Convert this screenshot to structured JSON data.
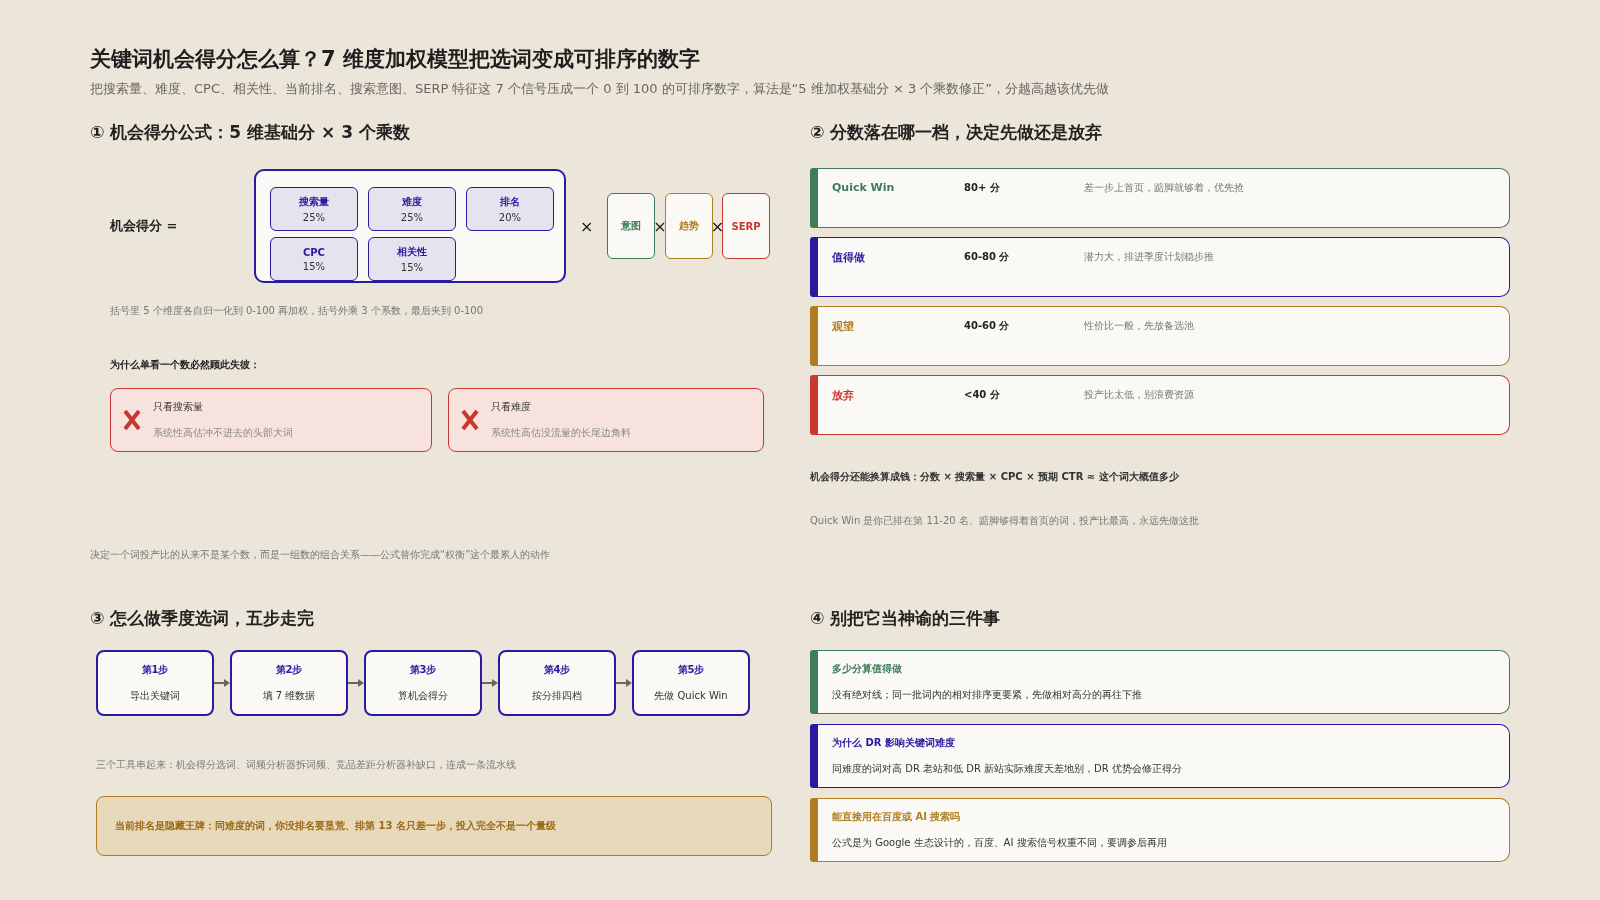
{
  "header": {
    "title": "关键词机会得分怎么算？7 维度加权模型把选词变成可排序的数字",
    "subtitle": "把搜索量、难度、CPC、相关性、当前排名、搜索意图、SERP 特征这 7 个信号压成一个 0 到 100 的可排序数字，算法是“5 维加权基础分 × 3 个乘数修正”，分越高越该优先做"
  },
  "formula_section": {
    "heading": "① 机会得分公式：5 维基础分 × 3 个乘数",
    "lhs": "机会得分 =",
    "weights": [
      {
        "name": "搜索量",
        "weight": "25%"
      },
      {
        "name": "难度",
        "weight": "25%"
      },
      {
        "name": "排名",
        "weight": "20%"
      },
      {
        "name": "CPC",
        "weight": "15%"
      },
      {
        "name": "相关性",
        "weight": "15%"
      }
    ],
    "multipliers": [
      {
        "sign": "×",
        "label": "意图",
        "color": "#3f7d5a"
      },
      {
        "sign": "×",
        "label": "趋势",
        "color": "#b07d22"
      },
      {
        "sign": "×",
        "label": "SERP",
        "color": "#c8382f"
      }
    ],
    "note": "括号里 5 个维度各自归一化到 0-100 再加权，括号外乘 3 个系数，最后夹到 0-100",
    "pitfall_heading": "为什么单看一个数必然顾此失彼：",
    "pitfalls": [
      {
        "title": "只看搜索量",
        "desc": "系统性高估冲不进去的头部大词"
      },
      {
        "title": "只看难度",
        "desc": "系统性高估没流量的长尾边角料"
      }
    ],
    "footer": "决定一个词投产比的从来不是某个数，而是一组数的组合关系——公式替你完成“权衡”这个最累人的动作"
  },
  "tiers_section": {
    "heading": "② 分数落在哪一档，决定先做还是放弃",
    "tiers": [
      {
        "name": "Quick Win",
        "range": "80+ 分",
        "desc": "差一步上首页，踮脚就够着，优先抢",
        "color": "#3f7d5a"
      },
      {
        "name": "值得做",
        "range": "60-80 分",
        "desc": "潜力大，排进季度计划稳步推",
        "color": "#2a1aa0"
      },
      {
        "name": "观望",
        "range": "40-60 分",
        "desc": "性价比一般，先放备选池",
        "color": "#b07d22"
      },
      {
        "name": "放弃",
        "range": "<40 分",
        "desc": "投产比太低，别浪费资源",
        "color": "#c8382f"
      }
    ],
    "money_note": "机会得分还能换算成钱：分数 × 搜索量 × CPC × 预期 CTR ≈ 这个词大概值多少",
    "note": "Quick Win 是你已排在第 11-20 名、踮脚够得着首页的词，投产比最高，永远先做这批"
  },
  "steps_section": {
    "heading": "③ 怎么做季度选词，五步走完",
    "steps": [
      {
        "title": "第1步",
        "desc": "导出关键词"
      },
      {
        "title": "第2步",
        "desc": "填 7 维数据"
      },
      {
        "title": "第3步",
        "desc": "算机会得分"
      },
      {
        "title": "第4步",
        "desc": "按分排四档"
      },
      {
        "title": "第5步",
        "desc": "先做 Quick Win"
      }
    ],
    "note": "三个工具串起来：机会得分选词、词频分析器拆词频、竞品差距分析器补缺口，连成一条流水线",
    "callout": "当前排名是隐藏王牌：同难度的词，你没排名要垦荒、排第 13 名只差一步，投入完全不是一个量级"
  },
  "caveats_section": {
    "heading": "④ 别把它当神谕的三件事",
    "items": [
      {
        "title": "多少分算值得做",
        "desc": "没有绝对线；同一批词内的相对排序更要紧，先做相对高分的再往下推",
        "color": "#3f7d5a"
      },
      {
        "title": "为什么 DR 影响关键词难度",
        "desc": "同难度的词对高 DR 老站和低 DR 新站实际难度天差地别，DR 优势会修正得分",
        "color": "#2a1aa0"
      },
      {
        "title": "能直接用在百度或 AI 搜索吗",
        "desc": "公式是为 Google 生态设计的，百度、AI 搜索信号权重不同，要调参后再用",
        "color": "#b07d22"
      }
    ]
  }
}
